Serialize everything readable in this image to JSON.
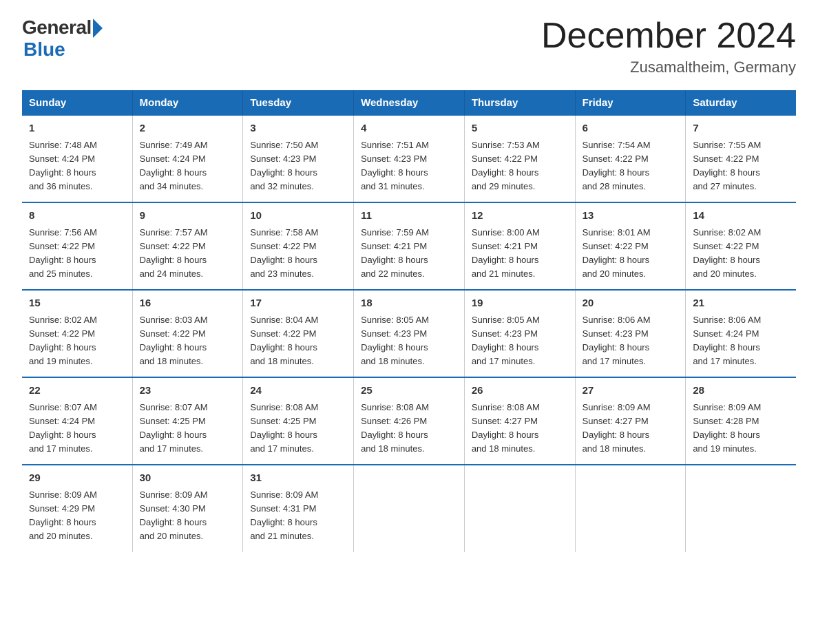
{
  "header": {
    "logo_general": "General",
    "logo_blue": "Blue",
    "title": "December 2024",
    "subtitle": "Zusamaltheim, Germany"
  },
  "days_of_week": [
    "Sunday",
    "Monday",
    "Tuesday",
    "Wednesday",
    "Thursday",
    "Friday",
    "Saturday"
  ],
  "weeks": [
    [
      {
        "day": "1",
        "info": "Sunrise: 7:48 AM\nSunset: 4:24 PM\nDaylight: 8 hours\nand 36 minutes."
      },
      {
        "day": "2",
        "info": "Sunrise: 7:49 AM\nSunset: 4:24 PM\nDaylight: 8 hours\nand 34 minutes."
      },
      {
        "day": "3",
        "info": "Sunrise: 7:50 AM\nSunset: 4:23 PM\nDaylight: 8 hours\nand 32 minutes."
      },
      {
        "day": "4",
        "info": "Sunrise: 7:51 AM\nSunset: 4:23 PM\nDaylight: 8 hours\nand 31 minutes."
      },
      {
        "day": "5",
        "info": "Sunrise: 7:53 AM\nSunset: 4:22 PM\nDaylight: 8 hours\nand 29 minutes."
      },
      {
        "day": "6",
        "info": "Sunrise: 7:54 AM\nSunset: 4:22 PM\nDaylight: 8 hours\nand 28 minutes."
      },
      {
        "day": "7",
        "info": "Sunrise: 7:55 AM\nSunset: 4:22 PM\nDaylight: 8 hours\nand 27 minutes."
      }
    ],
    [
      {
        "day": "8",
        "info": "Sunrise: 7:56 AM\nSunset: 4:22 PM\nDaylight: 8 hours\nand 25 minutes."
      },
      {
        "day": "9",
        "info": "Sunrise: 7:57 AM\nSunset: 4:22 PM\nDaylight: 8 hours\nand 24 minutes."
      },
      {
        "day": "10",
        "info": "Sunrise: 7:58 AM\nSunset: 4:22 PM\nDaylight: 8 hours\nand 23 minutes."
      },
      {
        "day": "11",
        "info": "Sunrise: 7:59 AM\nSunset: 4:21 PM\nDaylight: 8 hours\nand 22 minutes."
      },
      {
        "day": "12",
        "info": "Sunrise: 8:00 AM\nSunset: 4:21 PM\nDaylight: 8 hours\nand 21 minutes."
      },
      {
        "day": "13",
        "info": "Sunrise: 8:01 AM\nSunset: 4:22 PM\nDaylight: 8 hours\nand 20 minutes."
      },
      {
        "day": "14",
        "info": "Sunrise: 8:02 AM\nSunset: 4:22 PM\nDaylight: 8 hours\nand 20 minutes."
      }
    ],
    [
      {
        "day": "15",
        "info": "Sunrise: 8:02 AM\nSunset: 4:22 PM\nDaylight: 8 hours\nand 19 minutes."
      },
      {
        "day": "16",
        "info": "Sunrise: 8:03 AM\nSunset: 4:22 PM\nDaylight: 8 hours\nand 18 minutes."
      },
      {
        "day": "17",
        "info": "Sunrise: 8:04 AM\nSunset: 4:22 PM\nDaylight: 8 hours\nand 18 minutes."
      },
      {
        "day": "18",
        "info": "Sunrise: 8:05 AM\nSunset: 4:23 PM\nDaylight: 8 hours\nand 18 minutes."
      },
      {
        "day": "19",
        "info": "Sunrise: 8:05 AM\nSunset: 4:23 PM\nDaylight: 8 hours\nand 17 minutes."
      },
      {
        "day": "20",
        "info": "Sunrise: 8:06 AM\nSunset: 4:23 PM\nDaylight: 8 hours\nand 17 minutes."
      },
      {
        "day": "21",
        "info": "Sunrise: 8:06 AM\nSunset: 4:24 PM\nDaylight: 8 hours\nand 17 minutes."
      }
    ],
    [
      {
        "day": "22",
        "info": "Sunrise: 8:07 AM\nSunset: 4:24 PM\nDaylight: 8 hours\nand 17 minutes."
      },
      {
        "day": "23",
        "info": "Sunrise: 8:07 AM\nSunset: 4:25 PM\nDaylight: 8 hours\nand 17 minutes."
      },
      {
        "day": "24",
        "info": "Sunrise: 8:08 AM\nSunset: 4:25 PM\nDaylight: 8 hours\nand 17 minutes."
      },
      {
        "day": "25",
        "info": "Sunrise: 8:08 AM\nSunset: 4:26 PM\nDaylight: 8 hours\nand 18 minutes."
      },
      {
        "day": "26",
        "info": "Sunrise: 8:08 AM\nSunset: 4:27 PM\nDaylight: 8 hours\nand 18 minutes."
      },
      {
        "day": "27",
        "info": "Sunrise: 8:09 AM\nSunset: 4:27 PM\nDaylight: 8 hours\nand 18 minutes."
      },
      {
        "day": "28",
        "info": "Sunrise: 8:09 AM\nSunset: 4:28 PM\nDaylight: 8 hours\nand 19 minutes."
      }
    ],
    [
      {
        "day": "29",
        "info": "Sunrise: 8:09 AM\nSunset: 4:29 PM\nDaylight: 8 hours\nand 20 minutes."
      },
      {
        "day": "30",
        "info": "Sunrise: 8:09 AM\nSunset: 4:30 PM\nDaylight: 8 hours\nand 20 minutes."
      },
      {
        "day": "31",
        "info": "Sunrise: 8:09 AM\nSunset: 4:31 PM\nDaylight: 8 hours\nand 21 minutes."
      },
      {
        "day": "",
        "info": ""
      },
      {
        "day": "",
        "info": ""
      },
      {
        "day": "",
        "info": ""
      },
      {
        "day": "",
        "info": ""
      }
    ]
  ]
}
